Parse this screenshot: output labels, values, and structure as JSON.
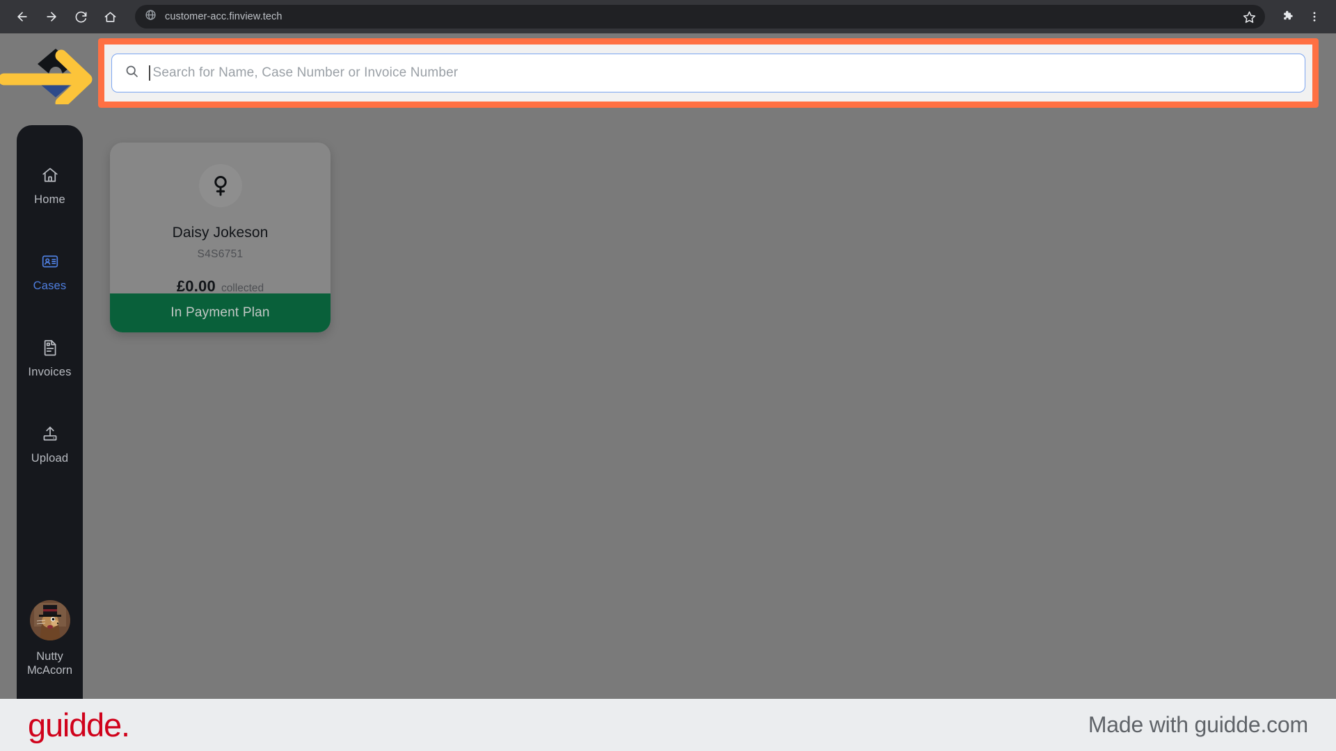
{
  "browser": {
    "url": "customer-acc.finview.tech",
    "back_label": "Back",
    "forward_label": "Forward",
    "reload_label": "Reload",
    "home_label": "Home",
    "bookmark_label": "Bookmark this tab",
    "extensions_label": "Extensions",
    "menu_label": "Customize and control Google Chrome"
  },
  "search": {
    "placeholder": "Search for Name, Case Number or Invoice Number",
    "value": "",
    "icon": "search-icon",
    "highlight_color": "#ff7043",
    "focus_border_color": "#7ba5f0"
  },
  "sidebar": {
    "items": [
      {
        "label": "Home",
        "icon": "home-icon",
        "active": false
      },
      {
        "label": "Cases",
        "icon": "id-card-icon",
        "active": true
      },
      {
        "label": "Invoices",
        "icon": "document-icon",
        "active": false
      },
      {
        "label": "Upload",
        "icon": "upload-icon",
        "active": false
      }
    ],
    "active_color": "#4f7fe0",
    "inactive_color": "#b9bcc2",
    "profile": {
      "name_line1": "Nutty",
      "name_line2": "McAcorn",
      "avatar_alt": "squirrel-in-top-hat-avatar"
    }
  },
  "cases": [
    {
      "name": "Daisy Jokeson",
      "case_number": "S4S6751",
      "amount": "£0.00",
      "amount_label": "collected",
      "status": "In Payment Plan",
      "status_color": "#09603a",
      "gender_icon": "venus-female-icon"
    }
  ],
  "footer": {
    "logo_text": "guidde.",
    "logo_color": "#d0021b",
    "made_with": "Made with guidde.com"
  }
}
